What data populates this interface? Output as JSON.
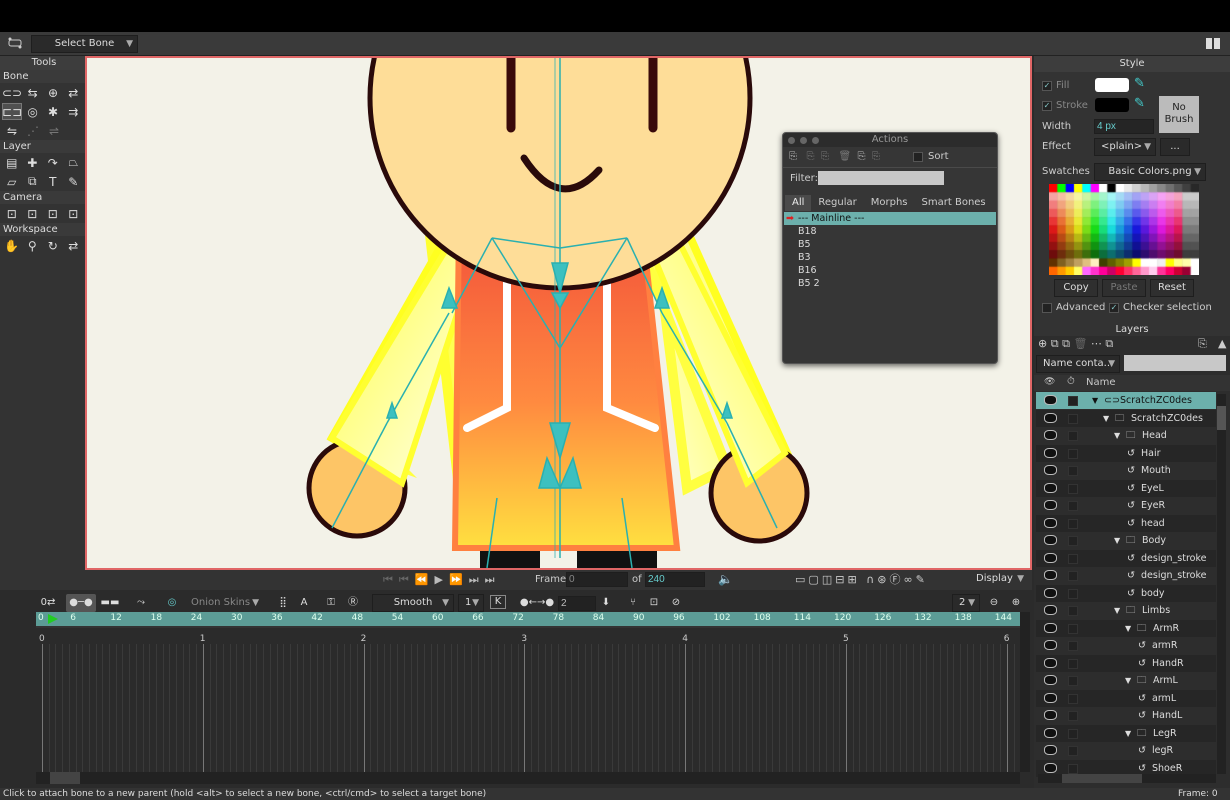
{
  "toolbar": {
    "tool_select": "Select Bone"
  },
  "tools": {
    "title": "Tools",
    "sections": [
      "Bone",
      "Layer",
      "Camera",
      "Workspace"
    ]
  },
  "actions": {
    "title": "Actions",
    "sort_label": "Sort",
    "filter_label": "Filter:",
    "filter_value": "",
    "tabs": [
      "All",
      "Regular",
      "Morphs",
      "Smart Bones"
    ],
    "items": [
      "--- Mainline ---",
      "B18",
      "B5",
      "B3",
      "B16",
      "B5 2"
    ]
  },
  "style": {
    "title": "Style",
    "fill_label": "Fill",
    "stroke_label": "Stroke",
    "width_label": "Width",
    "width_value": "4 px",
    "effect_label": "Effect",
    "effect_value": "<plain>",
    "effect_more": "...",
    "no_brush": "No Brush",
    "swatches_label": "Swatches",
    "swatches_value": "Basic Colors.png",
    "copy": "Copy",
    "paste": "Paste",
    "reset": "Reset",
    "advanced": "Advanced",
    "checker": "Checker selection",
    "fill_color": "#ffffff",
    "stroke_color": "#000000"
  },
  "layers": {
    "title": "Layers",
    "filter_mode": "Name conta...",
    "filter_value": "",
    "col_name": "Name",
    "rows": [
      {
        "name": "ScratchZC0des",
        "indent": 0,
        "kind": "bone-group",
        "expanded": true
      },
      {
        "name": "ScratchZC0des",
        "indent": 1,
        "kind": "folder",
        "expanded": true
      },
      {
        "name": "Head",
        "indent": 2,
        "kind": "folder",
        "expanded": true
      },
      {
        "name": "Hair",
        "indent": 3,
        "kind": "vector"
      },
      {
        "name": "Mouth",
        "indent": 3,
        "kind": "vector"
      },
      {
        "name": "EyeL",
        "indent": 3,
        "kind": "vector"
      },
      {
        "name": "EyeR",
        "indent": 3,
        "kind": "vector"
      },
      {
        "name": "head",
        "indent": 3,
        "kind": "vector"
      },
      {
        "name": "Body",
        "indent": 2,
        "kind": "folder",
        "expanded": true
      },
      {
        "name": "design_stroke",
        "indent": 3,
        "kind": "vector"
      },
      {
        "name": "design_stroke",
        "indent": 3,
        "kind": "vector"
      },
      {
        "name": "body",
        "indent": 3,
        "kind": "vector"
      },
      {
        "name": "Limbs",
        "indent": 2,
        "kind": "folder",
        "expanded": true
      },
      {
        "name": "ArmR",
        "indent": 3,
        "kind": "folder",
        "expanded": true
      },
      {
        "name": "armR",
        "indent": 4,
        "kind": "vector"
      },
      {
        "name": "HandR",
        "indent": 4,
        "kind": "vector"
      },
      {
        "name": "ArmL",
        "indent": 3,
        "kind": "folder",
        "expanded": true
      },
      {
        "name": "armL",
        "indent": 4,
        "kind": "vector"
      },
      {
        "name": "HandL",
        "indent": 4,
        "kind": "vector"
      },
      {
        "name": "LegR",
        "indent": 3,
        "kind": "folder",
        "expanded": true
      },
      {
        "name": "legR",
        "indent": 4,
        "kind": "vector"
      },
      {
        "name": "ShoeR",
        "indent": 4,
        "kind": "vector"
      }
    ]
  },
  "timeline": {
    "frame_label": "Frame",
    "frame_value": "0",
    "of_label": "of",
    "total_frames": "240",
    "display_label": "Display",
    "onion_skins": "Onion Skins",
    "interp": "Smooth",
    "interp_count": "1",
    "key_count": "2",
    "zoom_count": "2",
    "ruler_frames": [
      "0",
      "6",
      "12",
      "18",
      "24",
      "30",
      "36",
      "42",
      "48",
      "54",
      "60",
      "66",
      "72",
      "78",
      "84",
      "90",
      "96",
      "102",
      "108",
      "114",
      "120",
      "126",
      "132",
      "138",
      "144"
    ],
    "seconds": [
      "0",
      "1",
      "2",
      "3",
      "4",
      "5",
      "6"
    ]
  },
  "status": {
    "message": "Click to attach bone to a new parent (hold <alt> to select a new bone, <ctrl/cmd> to select a target bone)",
    "frame": "Frame: 0"
  }
}
